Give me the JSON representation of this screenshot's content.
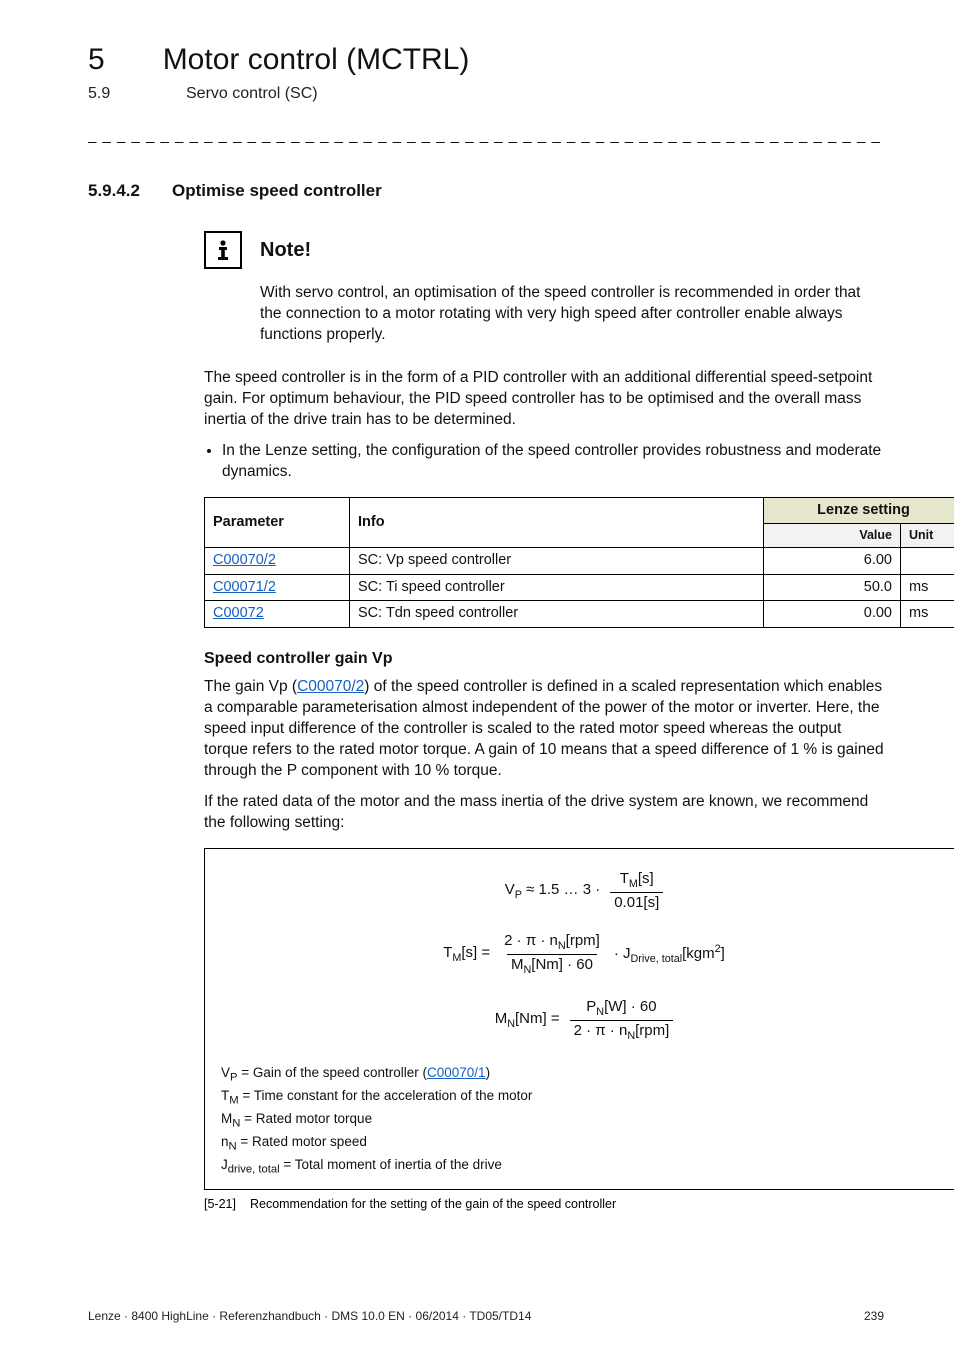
{
  "header": {
    "chapter_number": "5",
    "chapter_title": "Motor control (MCTRL)",
    "section_number": "5.9",
    "section_title": "Servo control (SC)"
  },
  "subsection": {
    "number": "5.9.4.2",
    "title": "Optimise speed controller"
  },
  "note": {
    "label": "Note!",
    "body": "With servo control, an optimisation of the speed controller is recommended in order that the connection to a motor rotating with very high speed after controller enable always functions properly."
  },
  "intro_para": "The speed controller is in the form of a PID controller with an additional differential speed-setpoint gain. For optimum behaviour, the PID speed controller has to be optimised and the overall mass inertia of the drive train has to be determined.",
  "bullet": "In the Lenze setting, the configuration of the speed controller provides robustness and moderate dynamics.",
  "table": {
    "headers": {
      "parameter": "Parameter",
      "info": "Info",
      "lenze": "Lenze setting",
      "value": "Value",
      "unit": "Unit"
    },
    "rows": [
      {
        "param": "C00070/2",
        "info": "SC: Vp speed controller",
        "value": "6.00",
        "unit": ""
      },
      {
        "param": "C00071/2",
        "info": "SC: Ti speed controller",
        "value": "50.0",
        "unit": "ms"
      },
      {
        "param": "C00072",
        "info": "SC: Tdn speed controller",
        "value": "0.00",
        "unit": "ms"
      }
    ]
  },
  "speed_gain": {
    "heading": "Speed controller gain Vp",
    "para1_a": "The gain Vp (",
    "para1_link": "C00070/2",
    "para1_b": ") of the speed controller is defined in a scaled representation which enables a comparable parameterisation almost independent of the power of the motor or inverter. Here, the speed input difference of the controller is scaled to the rated motor speed whereas the output torque refers to the rated motor torque. A gain of 10 means that a speed difference of 1 % is gained through the P component with 10 % torque.",
    "para2": "If the rated data of the motor and the mass inertia of the drive system are known, we recommend the following setting:"
  },
  "formulas": {
    "eq1": {
      "lhs": "V",
      "lsub": "P",
      "approx": "≈ 1.5 … 3 ·",
      "num": "T",
      "num_sub": "M",
      "num_unit": "[s]",
      "den": "0.01[s]"
    },
    "eq2": {
      "lhs": "T",
      "lsub": "M",
      "lhs_unit": "[s]",
      "eq": "=",
      "num": "2 · π · n",
      "num_sub": "N",
      "num_unit": "[rpm]",
      "den": "M",
      "den_sub": "N",
      "den_unit": "[Nm] · 60",
      "tail": " · J",
      "tail_sub": "Drive, total",
      "tail_unit": "[kgm",
      "tail_sup": "2",
      "tail_close": "]"
    },
    "eq3": {
      "lhs": "M",
      "lsub": "N",
      "lhs_unit": "[Nm]",
      "eq": "=",
      "num": "P",
      "num_sub": "N",
      "num_unit": "[W] · 60",
      "den": "2 · π · n",
      "den_sub": "N",
      "den_unit": "[rpm]"
    }
  },
  "defs": {
    "d1_a": "V",
    "d1_sub": "P",
    "d1_b": " = Gain of the speed controller (",
    "d1_link": "C00070/1",
    "d1_c": ")",
    "d2_a": "T",
    "d2_sub": "M",
    "d2_b": " = Time constant for the acceleration of the motor",
    "d3_a": "M",
    "d3_sub": "N",
    "d3_b": " = Rated motor torque",
    "d4_a": "n",
    "d4_sub": "N",
    "d4_b": " = Rated motor speed",
    "d5_a": "J",
    "d5_sub": "drive, total",
    "d5_b": " = Total moment of inertia of the drive"
  },
  "caption": {
    "label": "[5-21]",
    "text": "Recommendation for the setting of the gain of the speed controller"
  },
  "footer": {
    "left": "Lenze · 8400 HighLine · Referenzhandbuch · DMS 10.0 EN · 06/2014 · TD05/TD14",
    "right": "239"
  }
}
